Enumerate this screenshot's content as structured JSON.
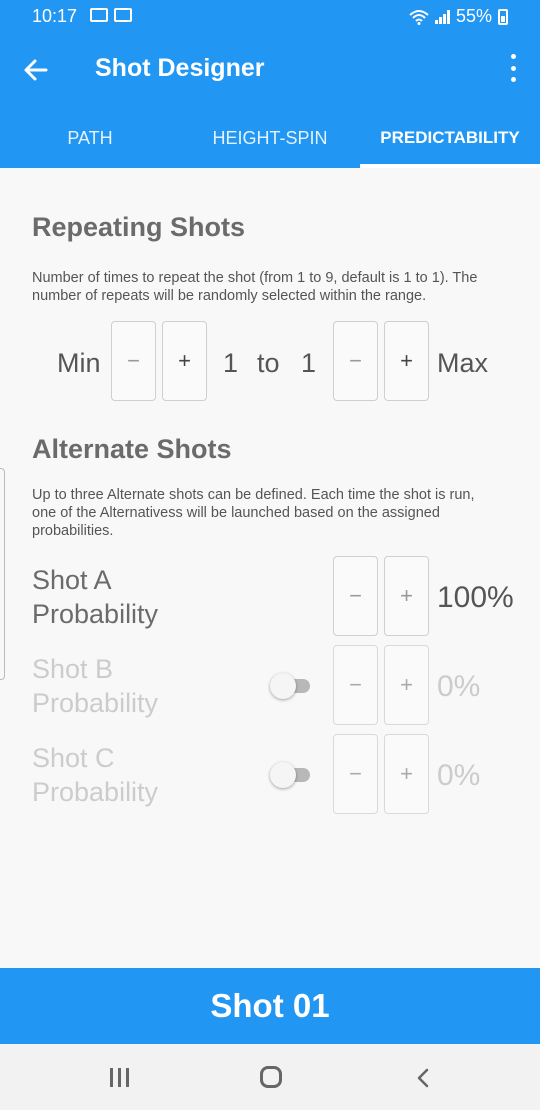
{
  "status": {
    "time": "10:17",
    "battery": "55%"
  },
  "appbar": {
    "title": "Shot Designer"
  },
  "tabs": [
    {
      "label": "PATH"
    },
    {
      "label": "HEIGHT-SPIN"
    },
    {
      "label": "PREDICTABILITY"
    }
  ],
  "repeating": {
    "title": "Repeating Shots",
    "description": "Number of times to repeat the shot (from 1 to 9, default is 1 to 1). The number of repeats will be randomly selected within the range.",
    "min_label": "Min",
    "min_value": "1",
    "to_label": "to",
    "max_value": "1",
    "max_label": "Max"
  },
  "alternate": {
    "title": "Alternate Shots",
    "description": "Up to three Alternate shots can be defined. Each time the shot is run, one of the Alternativess will be launched based on the assigned probabilities.",
    "shots": [
      {
        "label_line1": "Shot A",
        "label_line2": "Probability",
        "value": "100%",
        "enabled": true
      },
      {
        "label_line1": "Shot B",
        "label_line2": "Probability",
        "value": "0%",
        "enabled": false
      },
      {
        "label_line1": "Shot C",
        "label_line2": "Probability",
        "value": "0%",
        "enabled": false
      }
    ]
  },
  "buttons": {
    "minus": "−",
    "plus": "+"
  },
  "footer": {
    "label": "Shot 01"
  }
}
